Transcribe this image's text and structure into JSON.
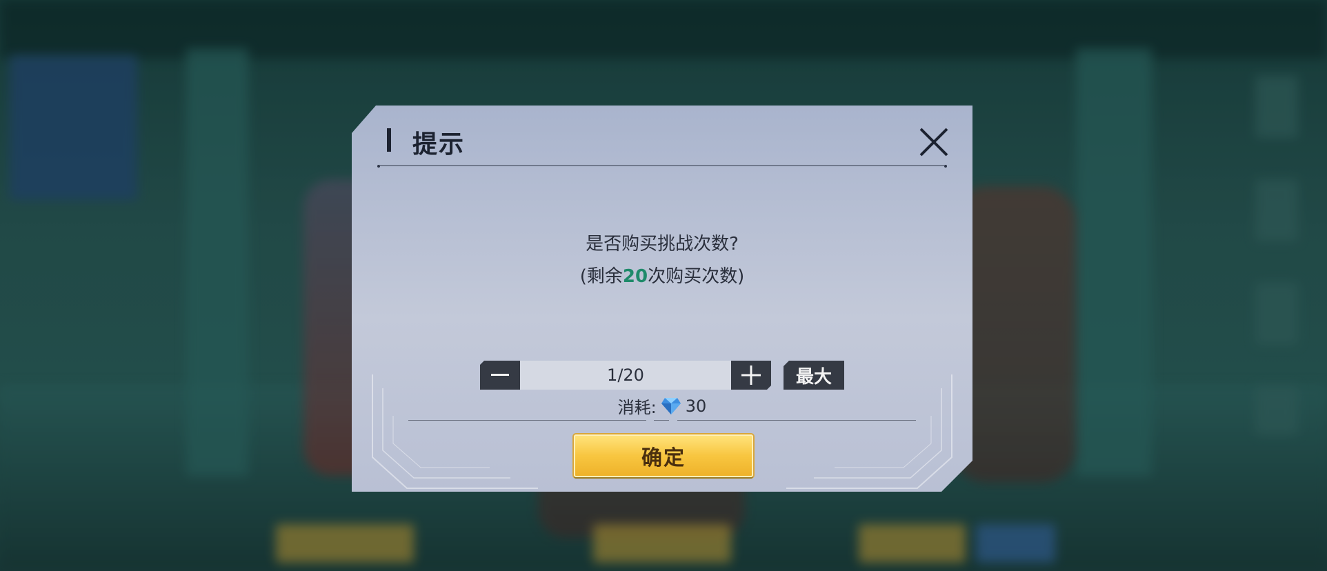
{
  "dialog": {
    "title": "提示",
    "message_line1": "是否购买挑战次数?",
    "message_line2_prefix": "(剩余",
    "message_line2_count": "20",
    "message_line2_suffix": "次购买次数)",
    "quantity": "1/20",
    "max_label": "最大",
    "cost_label": "消耗:",
    "cost_value": "30",
    "cost_icon": "diamond-icon",
    "confirm_label": "确定",
    "close_icon": "close-icon",
    "minus_icon": "minus-icon",
    "plus_icon": "plus-icon"
  },
  "colors": {
    "highlight": "#1e8a6a",
    "confirm_button": "#f8c640",
    "dialog_bg": "#c3c9d9",
    "stepper_button": "#353a44"
  }
}
